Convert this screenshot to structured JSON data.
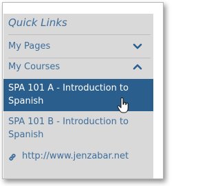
{
  "quick_links": {
    "title": "Quick Links",
    "items": [
      {
        "label": "My Pages",
        "state": "collapsed",
        "icon": "chevron-down-icon"
      },
      {
        "label": "My Courses",
        "state": "expanded",
        "icon": "chevron-up-icon"
      }
    ],
    "courses": [
      {
        "line1": "SPA 101 A - Introduction to",
        "line2": "Spanish",
        "active": true
      },
      {
        "line1": "SPA 101 B - Introduction to",
        "line2": "Spanish",
        "active": false
      }
    ],
    "external_link": {
      "label": "http://www.jenzabar.net",
      "icon": "link-icon"
    }
  },
  "colors": {
    "panel_bg": "#d9d9d9",
    "link_text": "#3e6e9b",
    "active_bg": "#2a5e8c",
    "active_text": "#ffffff"
  }
}
